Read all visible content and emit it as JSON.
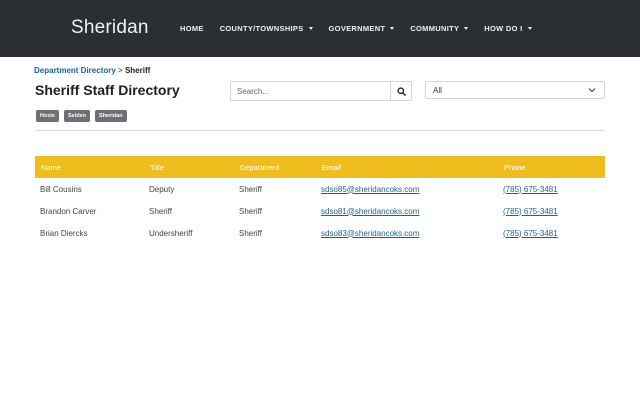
{
  "site": {
    "title": "Sheridan"
  },
  "nav": {
    "items": [
      {
        "label": "HOME",
        "dropdown": false
      },
      {
        "label": "COUNTY/TOWNSHIPS",
        "dropdown": true
      },
      {
        "label": "GOVERNMENT",
        "dropdown": true
      },
      {
        "label": "COMMUNITY",
        "dropdown": true
      },
      {
        "label": "HOW DO I",
        "dropdown": true
      }
    ]
  },
  "breadcrumb": {
    "parent": "Department Directory",
    "separator": ">",
    "current": "Sheriff"
  },
  "page": {
    "title": "Sheriff Staff Directory"
  },
  "search": {
    "placeholder": "Search...",
    "value": "",
    "icon": "search-icon"
  },
  "filter": {
    "selected": "All",
    "icon": "chevron-down-icon"
  },
  "tags": [
    "Hoxie",
    "Selden",
    "Sheridan"
  ],
  "table": {
    "columns": [
      "Name",
      "Title",
      "Department",
      "Email",
      "Phone"
    ],
    "rows": [
      {
        "name": "Bill Cousins",
        "title": "Deputy",
        "department": "Sheriff",
        "email": "sdso85@sheridancoks.com",
        "phone": "(785) 675-3481"
      },
      {
        "name": "Brandon Carver",
        "title": "Sheriff",
        "department": "Sheriff",
        "email": "sdso81@sheridancoks.com",
        "phone": "(785) 675-3481"
      },
      {
        "name": "Brian Diercks",
        "title": "Undersheriff",
        "department": "Sheriff",
        "email": "sdso83@sheridancoks.com",
        "phone": "(785) 675-3481"
      }
    ]
  },
  "colors": {
    "header_bg": "#2b2e33",
    "table_header_bg": "#f0bd1e",
    "link": "#1f5f9e",
    "tag_bg": "#6c6f73"
  }
}
